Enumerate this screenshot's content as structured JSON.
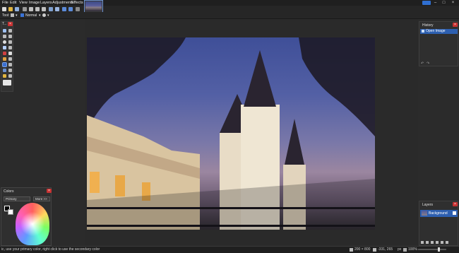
{
  "menu": [
    "File",
    "Edit",
    "View",
    "Image",
    "Layers",
    "Adjustments",
    "Effects"
  ],
  "toolbar": {
    "tool_label": "Tool:",
    "blend_mode": "Normal"
  },
  "tools_panel": {
    "title": "T...",
    "close": "×"
  },
  "history_panel": {
    "title": "History",
    "items": [
      "Open Image"
    ],
    "close": "×"
  },
  "layers_panel": {
    "title": "Layers",
    "layers": [
      "Background"
    ],
    "close": "×"
  },
  "colors_panel": {
    "title": "Colors",
    "mode": "Primary",
    "more_label": "More >>",
    "close": "×"
  },
  "status": {
    "hint": "ic, use your primary color, right click to use the secondary color",
    "image_size": "200 × 800",
    "cursor_pos": "-331, 265",
    "unit": "px",
    "zoom": "100%"
  },
  "colors": {
    "accent": "#2d5fb0",
    "close_red": "#c83232",
    "help_blue": "#2f6fd1"
  }
}
